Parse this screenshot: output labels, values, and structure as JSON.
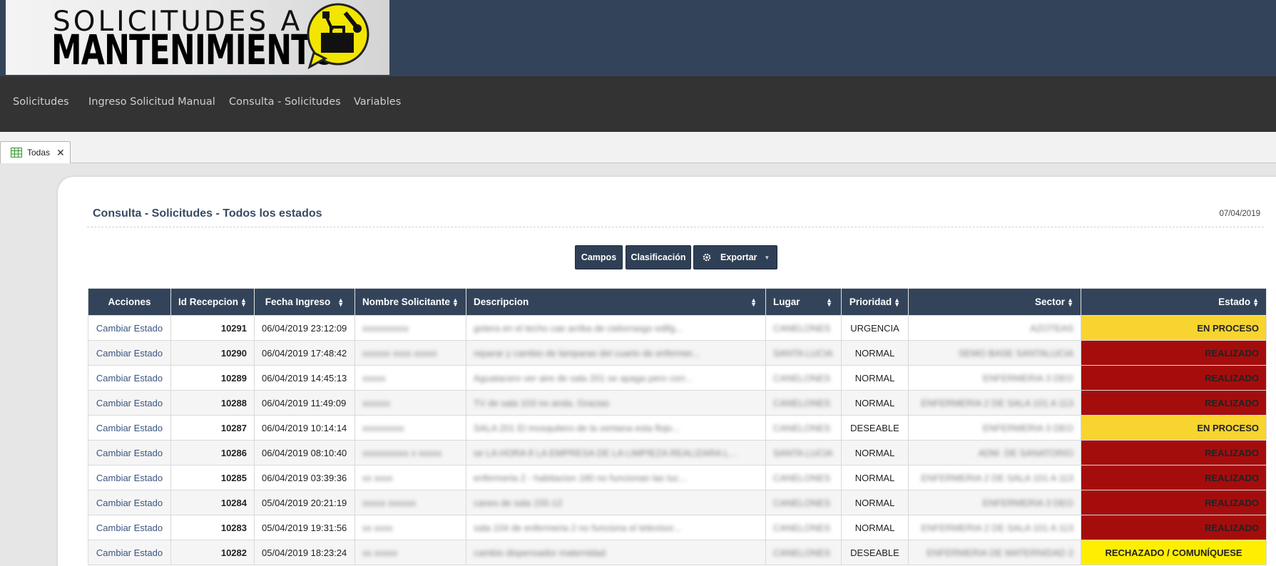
{
  "header": {
    "logo_line1": "SOLICITUDES A",
    "logo_line2": "MANTENIMIENTO",
    "logo_badge_icon": "toolbox-icon"
  },
  "nav": {
    "items": [
      {
        "label": "Solicitudes"
      },
      {
        "label": "Ingreso Solicitud Manual"
      },
      {
        "label": "Consulta - Solicitudes"
      },
      {
        "label": "Variables"
      }
    ]
  },
  "tabs": [
    {
      "label": "Todas",
      "icon": "grid-table-icon",
      "close": "✕"
    }
  ],
  "panel": {
    "title": "Consulta - Solicitudes - Todos los estados",
    "date": "07/04/2019"
  },
  "toolbar": {
    "campos_label": "Campos",
    "clasificacion_label": "Clasificación",
    "exportar_label": "Exportar",
    "exportar_icon": "gear-icon",
    "exportar_caret": "▼"
  },
  "table": {
    "columns": [
      "Acciones",
      "Id Recepcion",
      "Fecha Ingreso",
      "Nombre Solicitante",
      "Descripcion",
      "Lugar",
      "Prioridad",
      "Sector",
      "Estado"
    ],
    "sort_glyph_up": "▲",
    "sort_glyph_down": "▼",
    "rows": [
      {
        "accion": "Cambiar Estado",
        "id": "10291",
        "fecha": "06/04/2019 23:12:09",
        "nombre": "xxxxxxxxxx",
        "descripcion": "gotera en el techo cae arriba de cielorrasgo edifg...",
        "lugar": "CANELONES",
        "prioridad": "URGENCIA",
        "sector": "AZOTEAS",
        "estado": "EN PROCESO",
        "estado_class": "st-proceso"
      },
      {
        "accion": "Cambiar Estado",
        "id": "10290",
        "fecha": "06/04/2019 17:48:42",
        "nombre": "xxxxxx xxxx xxxxx",
        "descripcion": "reparar y cambio de lamparas del cuarto de enfermer...",
        "lugar": "SANTA LUCIA",
        "prioridad": "NORMAL",
        "sector": "SEMO BASE SANTALUCIA",
        "estado": "REALIZADO",
        "estado_class": "st-realizado"
      },
      {
        "accion": "Cambiar Estado",
        "id": "10289",
        "fecha": "06/04/2019 14:45:13",
        "nombre": "xxxxx",
        "descripcion": "Aguatacero ver aire de sala 201 se apaga pero corr...",
        "lugar": "CANELONES",
        "prioridad": "NORMAL",
        "sector": "ENFERMERIA 3 DEO",
        "estado": "REALIZADO",
        "estado_class": "st-realizado"
      },
      {
        "accion": "Cambiar Estado",
        "id": "10288",
        "fecha": "06/04/2019 11:49:09",
        "nombre": "xxxxxx",
        "descripcion": "TV de sala 103 no anda. Gracias",
        "lugar": "CANELONES",
        "prioridad": "NORMAL",
        "sector": "ENFERMERIA 2 DE SALA 101 A 113",
        "estado": "REALIZADO",
        "estado_class": "st-realizado"
      },
      {
        "accion": "Cambiar Estado",
        "id": "10287",
        "fecha": "06/04/2019 10:14:14",
        "nombre": "xxxxxxxxx",
        "descripcion": "SALA 201 El mosquitero de la ventana esta flojo...",
        "lugar": "CANELONES",
        "prioridad": "DESEABLE",
        "sector": "ENFERMERIA 3 DEO",
        "estado": "EN PROCESO",
        "estado_class": "st-proceso"
      },
      {
        "accion": "Cambiar Estado",
        "id": "10286",
        "fecha": "06/04/2019 08:10:40",
        "nombre": "xxxxxxxxxx x xxxxx",
        "descripcion": "se LA HORA 8 LA EMPRESA DE LA LIMPIEZA REALIZARA L...",
        "lugar": "SANTA LUCIA",
        "prioridad": "NORMAL",
        "sector": "ADM. DE SANATORIO",
        "estado": "REALIZADO",
        "estado_class": "st-realizado"
      },
      {
        "accion": "Cambiar Estado",
        "id": "10285",
        "fecha": "06/04/2019 03:39:36",
        "nombre": "xx xxxx",
        "descripcion": "enfermeria 2 - habitacion 180 no funcionan las luc...",
        "lugar": "CANELONES",
        "prioridad": "NORMAL",
        "sector": "ENFERMERIA 2 DE SALA 101 A 113",
        "estado": "REALIZADO",
        "estado_class": "st-realizado"
      },
      {
        "accion": "Cambiar Estado",
        "id": "10284",
        "fecha": "05/04/2019 20:21:19",
        "nombre": "xxxxx xxxxxx",
        "descripcion": "canes de sala 155-12",
        "lugar": "CANELONES",
        "prioridad": "NORMAL",
        "sector": "ENFERMERIA 3 DEO",
        "estado": "REALIZADO",
        "estado_class": "st-realizado"
      },
      {
        "accion": "Cambiar Estado",
        "id": "10283",
        "fecha": "05/04/2019 19:31:56",
        "nombre": "xx xxxx",
        "descripcion": "sala 104 de enfermeria 2 no funciona el televisor...",
        "lugar": "CANELONES",
        "prioridad": "NORMAL",
        "sector": "ENFERMERIA 2 DE SALA 101 A 113",
        "estado": "REALIZADO",
        "estado_class": "st-realizado"
      },
      {
        "accion": "Cambiar Estado",
        "id": "10282",
        "fecha": "05/04/2019 18:23:24",
        "nombre": "xx xxxxx",
        "descripcion": "cambio dispensador maternidad",
        "lugar": "CANELONES",
        "prioridad": "DESEABLE",
        "sector": "ENFERMERIA DE MATERNIDAD 2",
        "estado": "RECHAZADO / COMUNÍQUESE",
        "estado_class": "st-rechazado"
      }
    ]
  },
  "colors": {
    "header_bg": "#33445a",
    "nav_bg": "#333333",
    "en_proceso": "#f7d430",
    "realizado": "#a50d0d",
    "rechazado": "#ffee00"
  }
}
